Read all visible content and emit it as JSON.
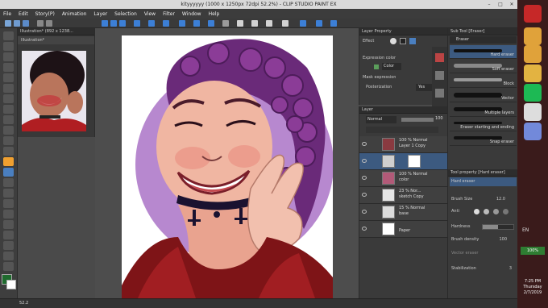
{
  "window": {
    "title": "kityyyyyy (1000 x 1250px 72dpi 52.2%) - CLIP STUDIO PAINT EX"
  },
  "menu": [
    "File",
    "Edit",
    "Story(P)",
    "Animation",
    "Layer",
    "Selection",
    "View",
    "Filter",
    "Window",
    "Help"
  ],
  "navigator": {
    "tab": "Illustration* (892 x 1238...",
    "file_label": "Illustration*"
  },
  "layer_property": {
    "title": "Layer Property",
    "effect_label": "Effect",
    "expression_color_label": "Expression color",
    "color_value": "Color",
    "mask_expression_label": "Mask expression",
    "posterization_label": "Posterization",
    "posterization_value": "Yes"
  },
  "layer_panel": {
    "title": "Layer",
    "blend_mode": "Normal",
    "opacity": "100",
    "layers": [
      {
        "line1": "100 % Normal",
        "line2": "Layer 1 Copy"
      },
      {
        "line1": "",
        "line2": ""
      },
      {
        "line1": "100 % Normal",
        "line2": "color"
      },
      {
        "line1": "23 % Nor...",
        "line2": "sketch Copy"
      },
      {
        "line1": "15 % Normal",
        "line2": "base"
      },
      {
        "line1": "",
        "line2": "Paper"
      }
    ]
  },
  "sub_tool": {
    "title": "Sub Tool [Eraser]",
    "group": "Eraser",
    "brushes": [
      "Hard eraser",
      "Soft eraser",
      "Block",
      "Vector",
      "Multiple layers",
      "Eraser starting and ending",
      "Snap eraser"
    ]
  },
  "tool_property": {
    "title": "Tool property [Hard eraser]",
    "preset": "Hard eraser",
    "brush_size_label": "Brush Size",
    "brush_size_value": "12.0",
    "aa_label": "Anti",
    "hardness_label": "Hardness",
    "brush_density_label": "Brush density",
    "brush_density_value": "100",
    "vector_eraser_label": "Vector eraser",
    "stabilization_label": "Stabilization",
    "stabilization_value": "3",
    "hardness_level": 0.5,
    "brush_density_level": 1.0,
    "stabilization_level": 0.3
  },
  "status": {
    "zoom": "52.2"
  },
  "taskbar": {
    "lang": "EN",
    "battery": "100%",
    "time": "7:25 PM",
    "day": "Thursday",
    "date": "2/7/2019"
  }
}
